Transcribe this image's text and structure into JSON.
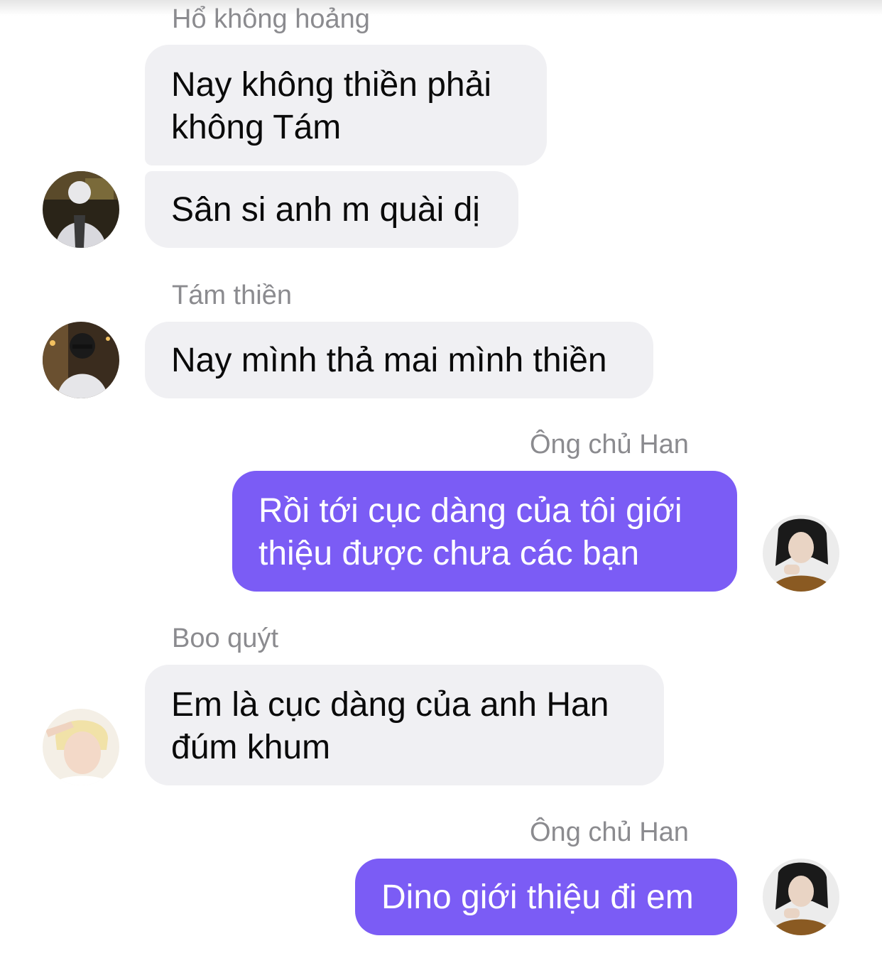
{
  "conversation": {
    "messages": [
      {
        "sender": "Hổ không hoảng",
        "text": "Nay không thiền phải\nkhông Tám",
        "direction": "incoming"
      },
      {
        "sender": "Hổ không hoảng",
        "text": "Sân si anh m quài dị",
        "direction": "incoming"
      },
      {
        "sender": "Tám thiền",
        "text": "Nay mình thả mai mình thiền",
        "direction": "incoming"
      },
      {
        "sender": "Ông chủ Han",
        "text": "Rồi tới cục dàng của tôi giới\nthiệu được chưa các bạn",
        "direction": "outgoing"
      },
      {
        "sender": "Boo quýt",
        "text": "Em là cục dàng của anh Han\nđúm khum",
        "direction": "incoming"
      },
      {
        "sender": "Ông chủ Han",
        "text": "Dino giới thiệu đi em",
        "direction": "outgoing"
      }
    ],
    "avatars": {
      "ho_khong_hoang": "avatar-photo",
      "tam_thien": "avatar-photo",
      "ong_chu_han": "avatar-photo",
      "boo_quyt": "avatar-photo"
    }
  },
  "colors": {
    "incoming_bubble": "#f0f0f3",
    "outgoing_bubble": "#7b5cf5",
    "sender_name": "#8b8b8f"
  }
}
